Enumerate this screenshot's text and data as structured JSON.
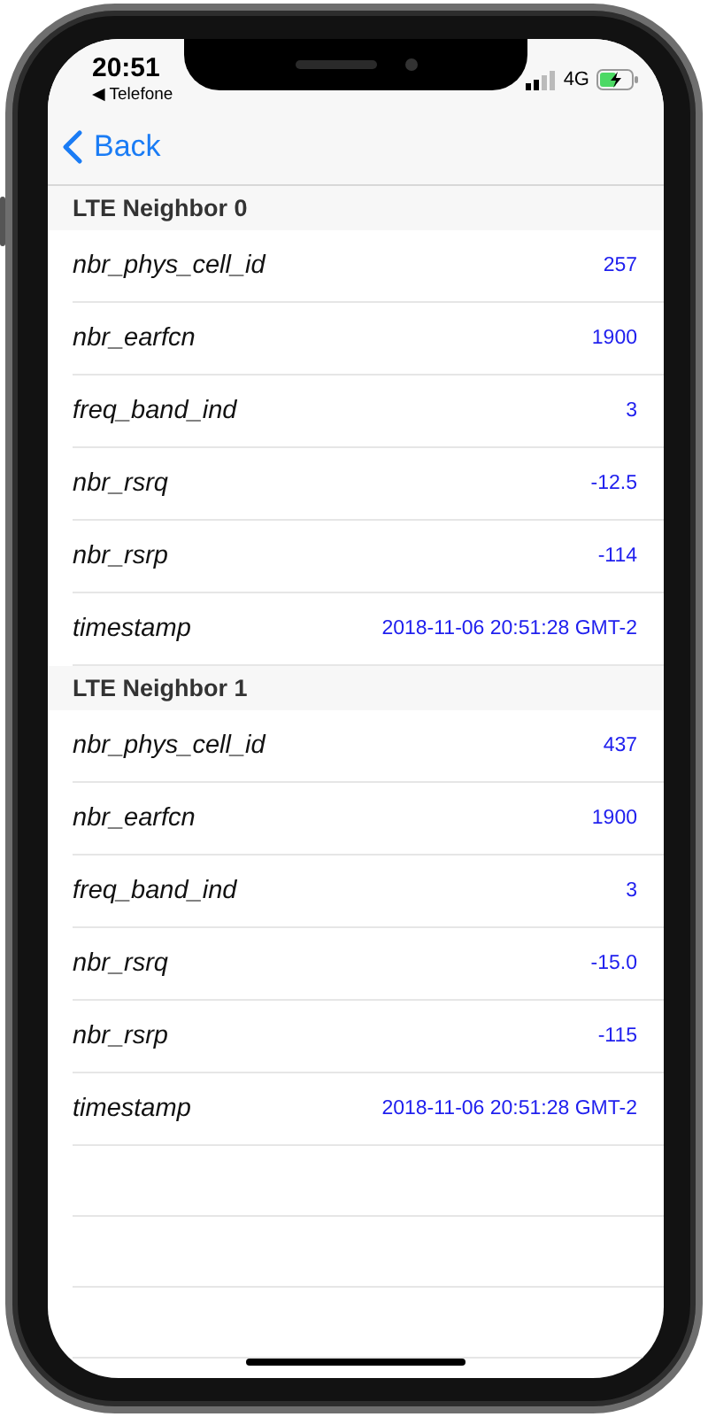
{
  "status_bar": {
    "time": "20:51",
    "back_app": "◀ Telefone",
    "network": "4G"
  },
  "nav": {
    "back": "Back"
  },
  "sections": [
    {
      "title": "LTE Neighbor 0",
      "rows": [
        {
          "label": "nbr_phys_cell_id",
          "value": "257"
        },
        {
          "label": "nbr_earfcn",
          "value": "1900"
        },
        {
          "label": "freq_band_ind",
          "value": "3"
        },
        {
          "label": "nbr_rsrq",
          "value": "-12.5"
        },
        {
          "label": "nbr_rsrp",
          "value": "-114"
        },
        {
          "label": "timestamp",
          "value": "2018-11-06 20:51:28 GMT-2"
        }
      ]
    },
    {
      "title": "LTE Neighbor 1",
      "rows": [
        {
          "label": "nbr_phys_cell_id",
          "value": "437"
        },
        {
          "label": "nbr_earfcn",
          "value": "1900"
        },
        {
          "label": "freq_band_ind",
          "value": "3"
        },
        {
          "label": "nbr_rsrq",
          "value": "-15.0"
        },
        {
          "label": "nbr_rsrp",
          "value": "-115"
        },
        {
          "label": "timestamp",
          "value": "2018-11-06 20:51:28 GMT-2"
        }
      ]
    }
  ]
}
